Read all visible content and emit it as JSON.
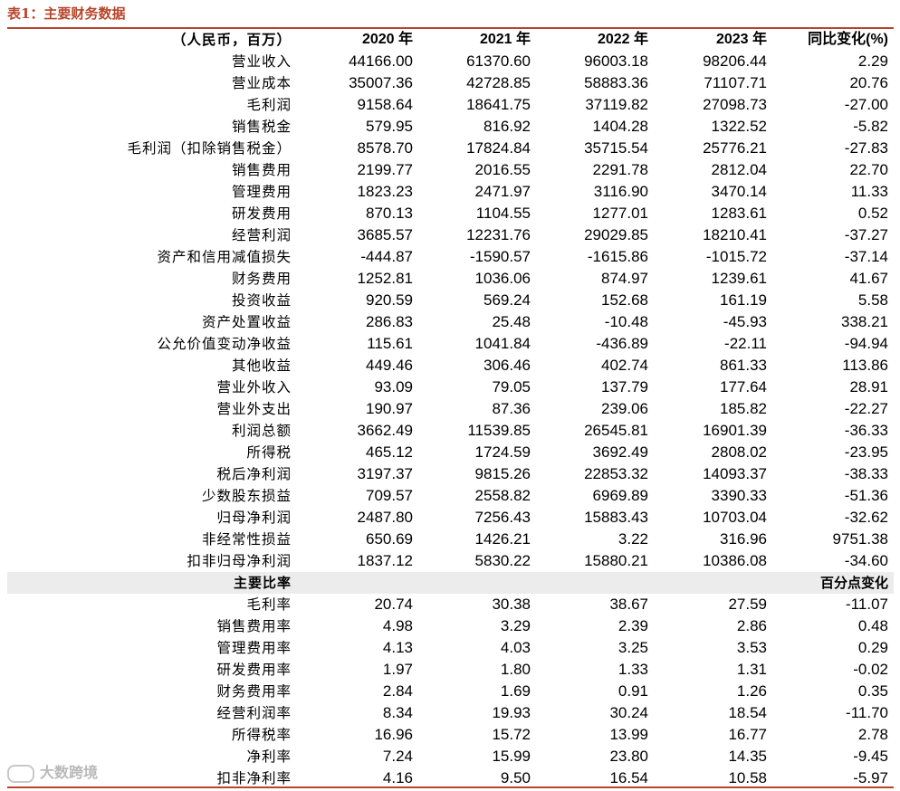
{
  "title": "表1：主要财务数据",
  "header": [
    "（人民币，百万）",
    "2020 年",
    "2021 年",
    "2022 年",
    "2023 年",
    "同比变化(%)"
  ],
  "rows": [
    [
      "营业收入",
      "44166.00",
      "61370.60",
      "96003.18",
      "98206.44",
      "2.29"
    ],
    [
      "营业成本",
      "35007.36",
      "42728.85",
      "58883.36",
      "71107.71",
      "20.76"
    ],
    [
      "毛利润",
      "9158.64",
      "18641.75",
      "37119.82",
      "27098.73",
      "-27.00"
    ],
    [
      "销售税金",
      "579.95",
      "816.92",
      "1404.28",
      "1322.52",
      "-5.82"
    ],
    [
      "毛利润（扣除销售税金）",
      "8578.70",
      "17824.84",
      "35715.54",
      "25776.21",
      "-27.83"
    ],
    [
      "销售费用",
      "2199.77",
      "2016.55",
      "2291.78",
      "2812.04",
      "22.70"
    ],
    [
      "管理费用",
      "1823.23",
      "2471.97",
      "3116.90",
      "3470.14",
      "11.33"
    ],
    [
      "研发费用",
      "870.13",
      "1104.55",
      "1277.01",
      "1283.61",
      "0.52"
    ],
    [
      "经营利润",
      "3685.57",
      "12231.76",
      "29029.85",
      "18210.41",
      "-37.27"
    ],
    [
      "资产和信用减值损失",
      "-444.87",
      "-1590.57",
      "-1615.86",
      "-1015.72",
      "-37.14"
    ],
    [
      "财务费用",
      "1252.81",
      "1036.06",
      "874.97",
      "1239.61",
      "41.67"
    ],
    [
      "投资收益",
      "920.59",
      "569.24",
      "152.68",
      "161.19",
      "5.58"
    ],
    [
      "资产处置收益",
      "286.83",
      "25.48",
      "-10.48",
      "-45.93",
      "338.21"
    ],
    [
      "公允价值变动净收益",
      "115.61",
      "1041.84",
      "-436.89",
      "-22.11",
      "-94.94"
    ],
    [
      "其他收益",
      "449.46",
      "306.46",
      "402.74",
      "861.33",
      "113.86"
    ],
    [
      "营业外收入",
      "93.09",
      "79.05",
      "137.79",
      "177.64",
      "28.91"
    ],
    [
      "营业外支出",
      "190.97",
      "87.36",
      "239.06",
      "185.82",
      "-22.27"
    ],
    [
      "利润总额",
      "3662.49",
      "11539.85",
      "26545.81",
      "16901.39",
      "-36.33"
    ],
    [
      "所得税",
      "465.12",
      "1724.59",
      "3692.49",
      "2808.02",
      "-23.95"
    ],
    [
      "税后净利润",
      "3197.37",
      "9815.26",
      "22853.32",
      "14093.37",
      "-38.33"
    ],
    [
      "少数股东损益",
      "709.57",
      "2558.82",
      "6969.89",
      "3390.33",
      "-51.36"
    ],
    [
      "归母净利润",
      "2487.80",
      "7256.43",
      "15883.43",
      "10703.04",
      "-32.62"
    ],
    [
      "非经常性损益",
      "650.69",
      "1426.21",
      "3.22",
      "316.96",
      "9751.38"
    ],
    [
      "扣非归母净利润",
      "1837.12",
      "5830.22",
      "15880.21",
      "10386.08",
      "-34.60"
    ]
  ],
  "ratio_section": {
    "label": "主要比率",
    "change_label": "百分点变化"
  },
  "ratios": [
    [
      "毛利率",
      "20.74",
      "30.38",
      "38.67",
      "27.59",
      "-11.07"
    ],
    [
      "销售费用率",
      "4.98",
      "3.29",
      "2.39",
      "2.86",
      "0.48"
    ],
    [
      "管理费用率",
      "4.13",
      "4.03",
      "3.25",
      "3.53",
      "0.29"
    ],
    [
      "研发费用率",
      "1.97",
      "1.80",
      "1.33",
      "1.31",
      "-0.02"
    ],
    [
      "财务费用率",
      "2.84",
      "1.69",
      "0.91",
      "1.26",
      "0.35"
    ],
    [
      "经营利润率",
      "8.34",
      "19.93",
      "30.24",
      "18.54",
      "-11.70"
    ],
    [
      "所得税率",
      "16.96",
      "15.72",
      "13.99",
      "16.77",
      "2.78"
    ],
    [
      "净利率",
      "7.24",
      "15.99",
      "23.80",
      "14.35",
      "-9.45"
    ],
    [
      "扣非净利率",
      "4.16",
      "9.50",
      "16.54",
      "10.58",
      "-5.97"
    ]
  ],
  "watermark": "大数跨境",
  "colors": {
    "accent": "#b8452a",
    "section_bg": "#ececec"
  }
}
